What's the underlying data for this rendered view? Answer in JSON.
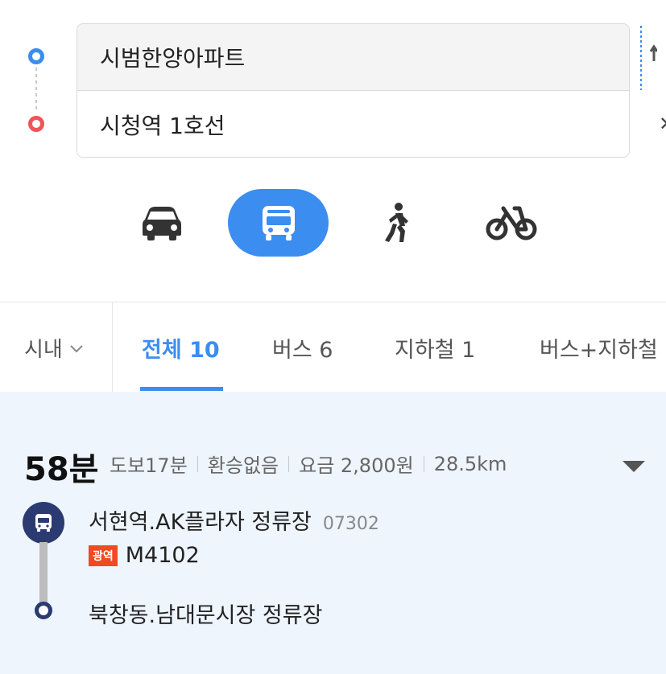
{
  "search": {
    "origin": "시범한양아파트",
    "destination": "시청역 1호선"
  },
  "modes": [
    {
      "name": "car",
      "icon": "car-icon",
      "active": false
    },
    {
      "name": "transit",
      "icon": "bus-icon",
      "active": true
    },
    {
      "name": "walk",
      "icon": "walk-icon",
      "active": false
    },
    {
      "name": "bike",
      "icon": "bike-icon",
      "active": false
    }
  ],
  "tabs": {
    "area": "시내",
    "items": [
      "전체 10",
      "버스 6",
      "지하철 1",
      "버스+지하철"
    ],
    "active_index": 0
  },
  "result": {
    "duration": "58분",
    "walk": "도보17분",
    "transfer": "환승없음",
    "fare": "요금 2,800원",
    "distance": "28.5km",
    "board_stop": "서현역.AK플라자 정류장",
    "board_stop_id": "07302",
    "route_badge": "광역",
    "route_number": "M4102",
    "alight_stop": "북창동.남대문시장 정류장"
  },
  "colors": {
    "accent": "#3b8df0",
    "origin": "#3b8df0",
    "destination": "#f0545a",
    "bus_navy": "#2b3b72",
    "badge_red": "#f04a23",
    "result_bg": "#eef5fd"
  }
}
